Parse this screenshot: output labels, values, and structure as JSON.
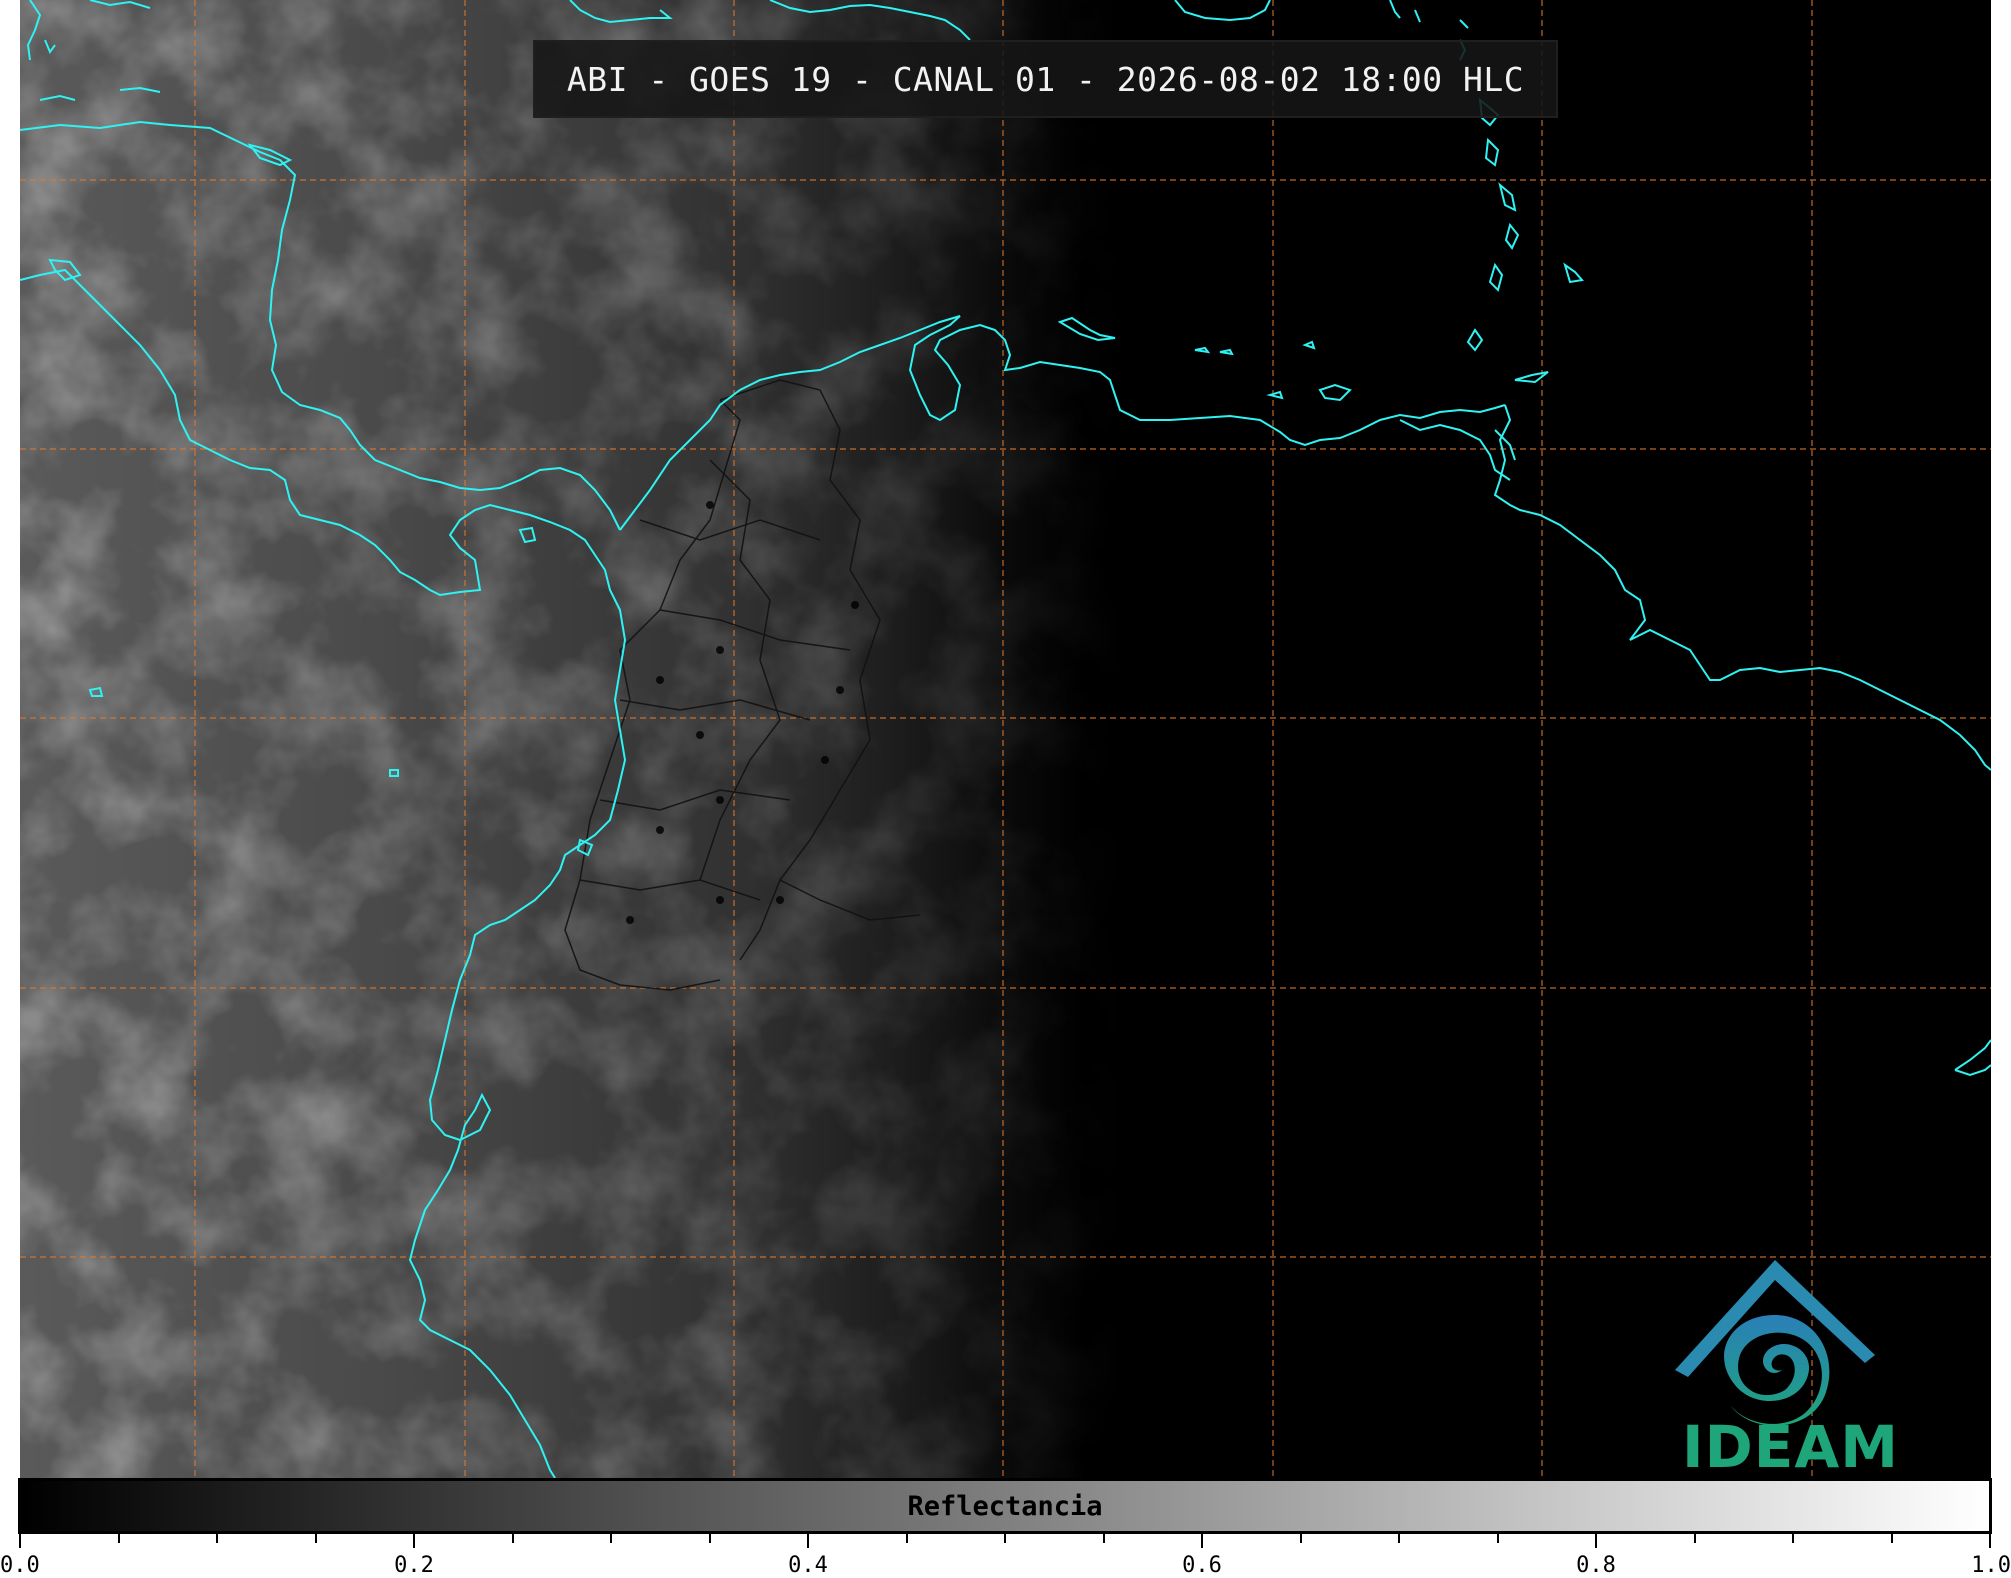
{
  "title": "ABI - GOES 19 - CANAL 01 - 2026-08-02 18:00 HLC",
  "logo": {
    "text": "IDEAM",
    "colors": {
      "blue": "#2a7fb8",
      "green": "#1ea67a"
    }
  },
  "colorbar": {
    "label": "Reflectancia",
    "min": 0.0,
    "max": 1.0,
    "tick_labels": [
      "0.0",
      "0.2",
      "0.4",
      "0.6",
      "0.8",
      "1.0"
    ],
    "minor_step": 0.05,
    "colormap": [
      "#000000",
      "#ffffff"
    ]
  },
  "map": {
    "coastline_color": "#2ff2f2",
    "gridline_color": "#e07a2e",
    "border_color": "#111111",
    "background": "#000000"
  }
}
